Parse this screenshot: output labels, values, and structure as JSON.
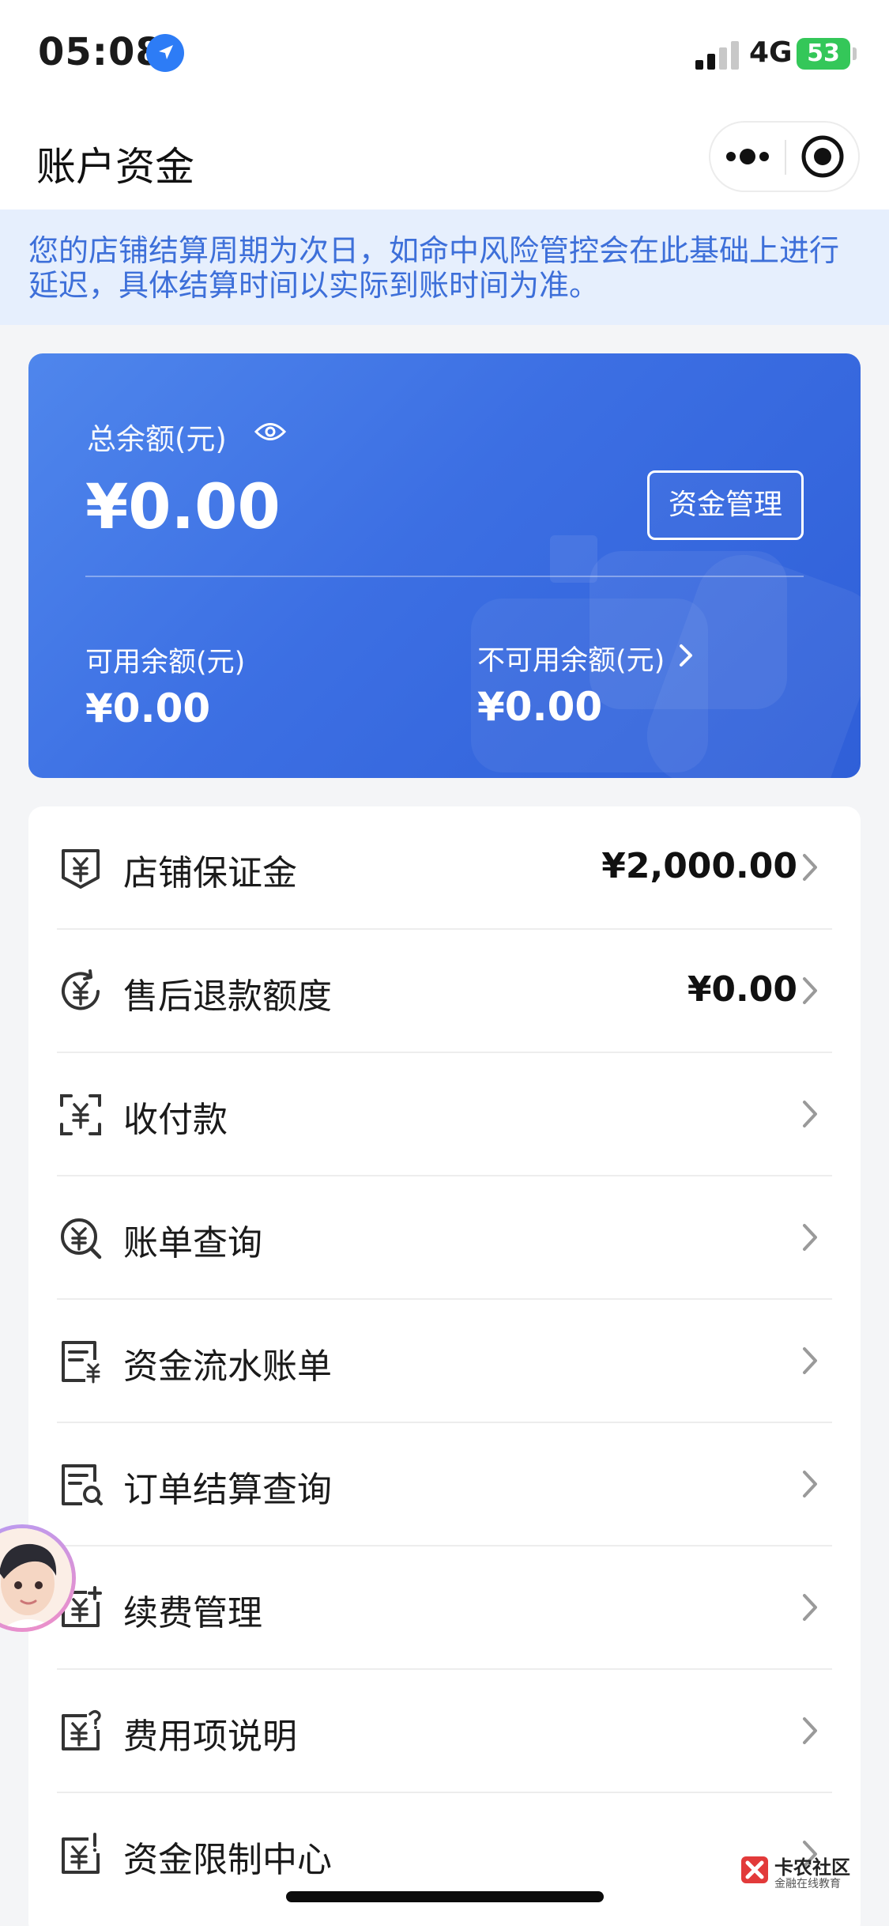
{
  "status_bar": {
    "time": "05:08",
    "network": "4G",
    "battery": "53"
  },
  "nav": {
    "title": "账户资金"
  },
  "notice": {
    "text": "您的店铺结算周期为次日，如命中风险管控会在此基础上进行延迟，具体结算时间以实际到账时间为准。"
  },
  "balance": {
    "total_label": "总余额(元)",
    "total_value": "¥0.00",
    "manage_button": "资金管理",
    "available_label": "可用余额(元)",
    "available_value": "¥0.00",
    "unavailable_label": "不可用余额(元)",
    "unavailable_value": "¥0.00"
  },
  "menu": {
    "items": [
      {
        "label": "店铺保证金",
        "value": "¥2,000.00",
        "icon": "deposit-icon"
      },
      {
        "label": "售后退款额度",
        "value": "¥0.00",
        "icon": "refund-quota-icon"
      },
      {
        "label": "收付款",
        "value": "",
        "icon": "scan-payment-icon"
      },
      {
        "label": "账单查询",
        "value": "",
        "icon": "bill-search-icon"
      },
      {
        "label": "资金流水账单",
        "value": "",
        "icon": "fund-flow-icon"
      },
      {
        "label": "订单结算查询",
        "value": "",
        "icon": "order-settlement-icon"
      },
      {
        "label": "续费管理",
        "value": "",
        "icon": "renewal-icon"
      },
      {
        "label": "费用项说明",
        "value": "",
        "icon": "fee-info-icon"
      },
      {
        "label": "资金限制中心",
        "value": "",
        "icon": "fund-limit-icon"
      }
    ]
  },
  "watermark": {
    "title": "卡农社区",
    "subtitle": "金融在线教育"
  },
  "colors": {
    "accent": "#3c6fe3",
    "notice_text": "#3d6fd9",
    "notice_bg": "#e6effd"
  }
}
